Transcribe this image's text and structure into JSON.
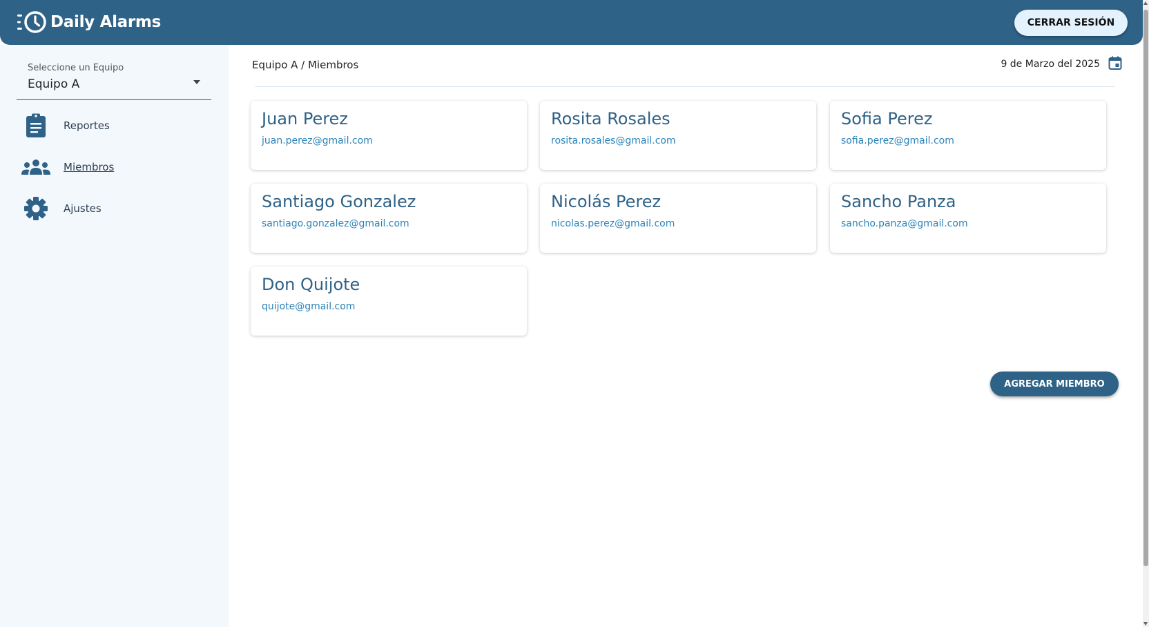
{
  "app": {
    "title": "Daily Alarms",
    "logo_icon": "clock-alarm-icon"
  },
  "header": {
    "logout_label": "CERRAR SESIÓN"
  },
  "sidebar": {
    "team_select": {
      "label": "Seleccione un Equipo",
      "value": "Equipo A"
    },
    "items": [
      {
        "label": "Reportes",
        "icon": "clipboard-icon",
        "active": false
      },
      {
        "label": "Miembros",
        "icon": "group-icon",
        "active": true
      },
      {
        "label": "Ajustes",
        "icon": "gear-icon",
        "active": false
      }
    ]
  },
  "main": {
    "breadcrumb": "Equipo A / Miembros",
    "date": "9 de Marzo del 2025",
    "date_icon": "calendar-icon",
    "members": [
      {
        "name": "Juan Perez",
        "email": "juan.perez@gmail.com"
      },
      {
        "name": "Rosita Rosales",
        "email": "rosita.rosales@gmail.com"
      },
      {
        "name": "Sofia Perez",
        "email": "sofia.perez@gmail.com"
      },
      {
        "name": "Santiago Gonzalez",
        "email": "santiago.gonzalez@gmail.com"
      },
      {
        "name": "Nicolás Perez",
        "email": "nicolas.perez@gmail.com"
      },
      {
        "name": "Sancho Panza",
        "email": "sancho.panza@gmail.com"
      },
      {
        "name": "Don Quijote",
        "email": "quijote@gmail.com"
      }
    ],
    "add_member_label": "AGREGAR MIEMBRO"
  },
  "colors": {
    "primary": "#2f6287",
    "link": "#2a83b8",
    "sidebar_bg": "#f3f8fc",
    "logout_bg": "#e3f2fd"
  }
}
